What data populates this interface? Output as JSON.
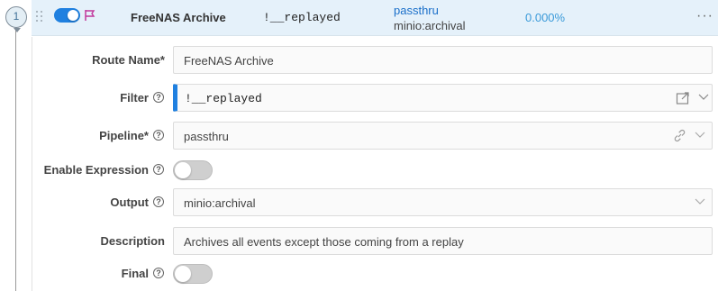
{
  "route": {
    "step_number": "1",
    "enabled": true,
    "name": "FreeNAS Archive",
    "filter": "!__replayed",
    "pipeline": "passthru",
    "output": "minio:archival",
    "percent": "0.000%",
    "menu": "···"
  },
  "form": {
    "route_name_label": "Route Name*",
    "route_name_value": "FreeNAS Archive",
    "filter_label": "Filter",
    "filter_value": "!__replayed",
    "pipeline_label": "Pipeline*",
    "pipeline_value": "passthru",
    "enable_expression_label": "Enable Expression",
    "enable_expression_on": false,
    "output_label": "Output",
    "output_value": "minio:archival",
    "description_label": "Description",
    "description_value": "Archives all events except those coming from a replay",
    "final_label": "Final",
    "final_on": false
  },
  "help_glyph": "?",
  "colors": {
    "accent": "#1f80e0",
    "header_bg": "#e5f1fa",
    "flag": "#c2379b",
    "percent": "#3a9ad9"
  },
  "icons": [
    "drag-handle-icon",
    "flag-icon",
    "expand-editor-icon",
    "link-icon",
    "chevron-down-icon",
    "help-icon",
    "more-icon"
  ]
}
